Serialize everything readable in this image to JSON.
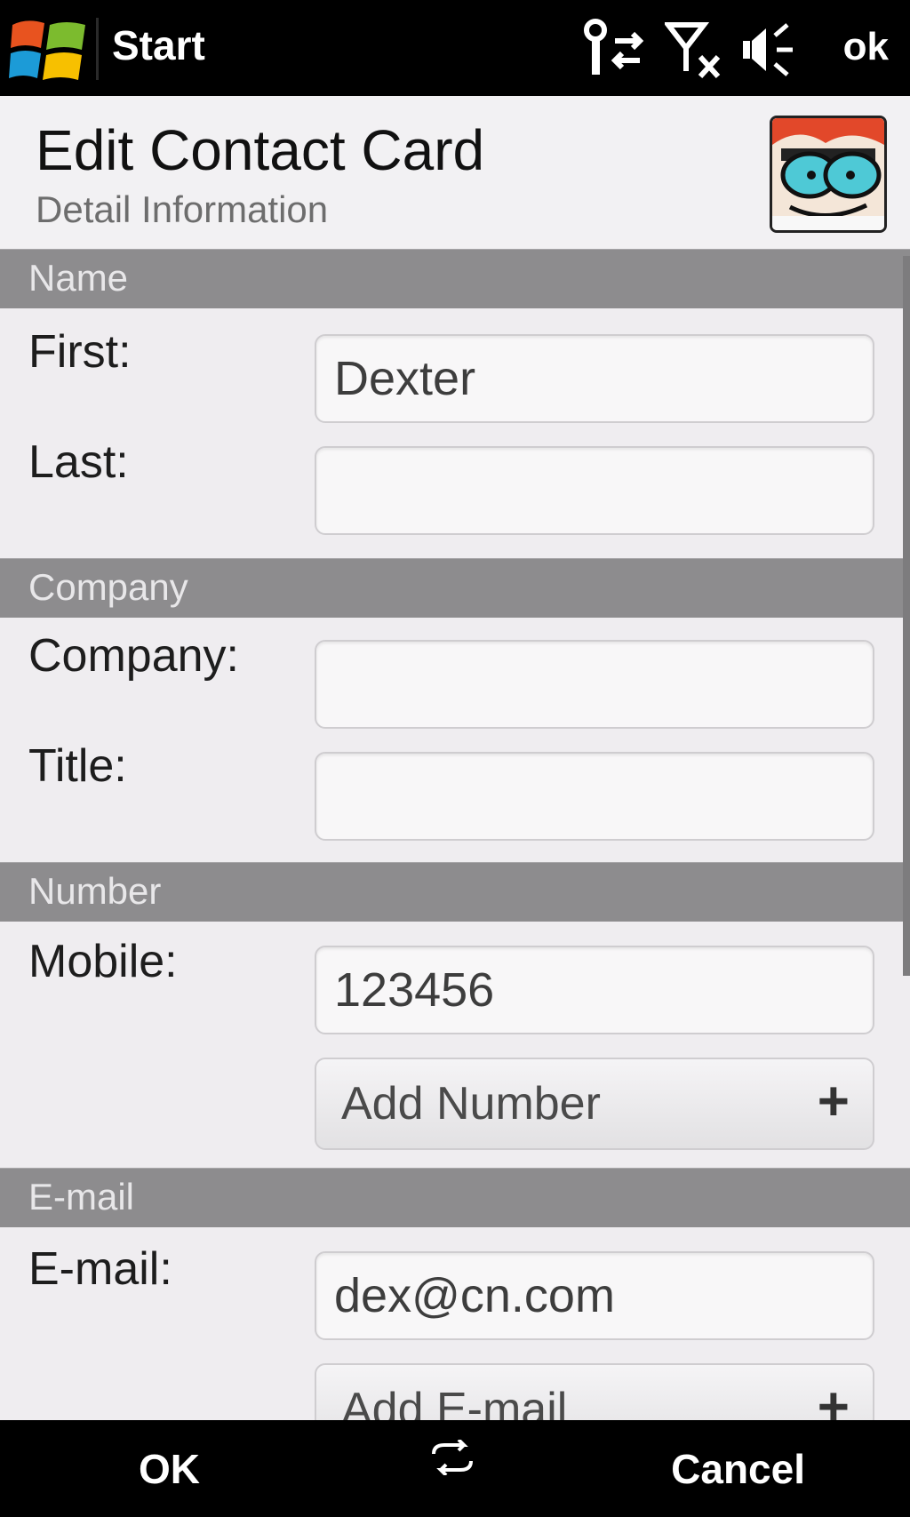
{
  "status_bar": {
    "start_label": "Start",
    "ok_label": "ok",
    "icons": [
      "windows-logo-icon",
      "data-connection-icon",
      "signal-off-icon",
      "speaker-icon"
    ]
  },
  "header": {
    "title": "Edit Contact Card",
    "subtitle": "Detail Information",
    "avatar_icon": "contact-photo-icon"
  },
  "sections": {
    "name": {
      "label": "Name",
      "first_label": "First:",
      "first_value": "Dexter",
      "last_label": "Last:",
      "last_value": ""
    },
    "company": {
      "label": "Company",
      "company_label": "Company:",
      "company_value": "",
      "title_label": "Title:",
      "title_value": ""
    },
    "number": {
      "label": "Number",
      "mobile_label": "Mobile:",
      "mobile_value": "123456",
      "add_label": "Add Number",
      "add_symbol": "+"
    },
    "email": {
      "label": "E-mail",
      "email_label": "E-mail:",
      "email_value": "dex@cn.com",
      "add_label": "Add E-mail",
      "add_symbol": "+"
    }
  },
  "softkeys": {
    "left": "OK",
    "right": "Cancel",
    "center_icon": "keyboard-sip-icon"
  }
}
